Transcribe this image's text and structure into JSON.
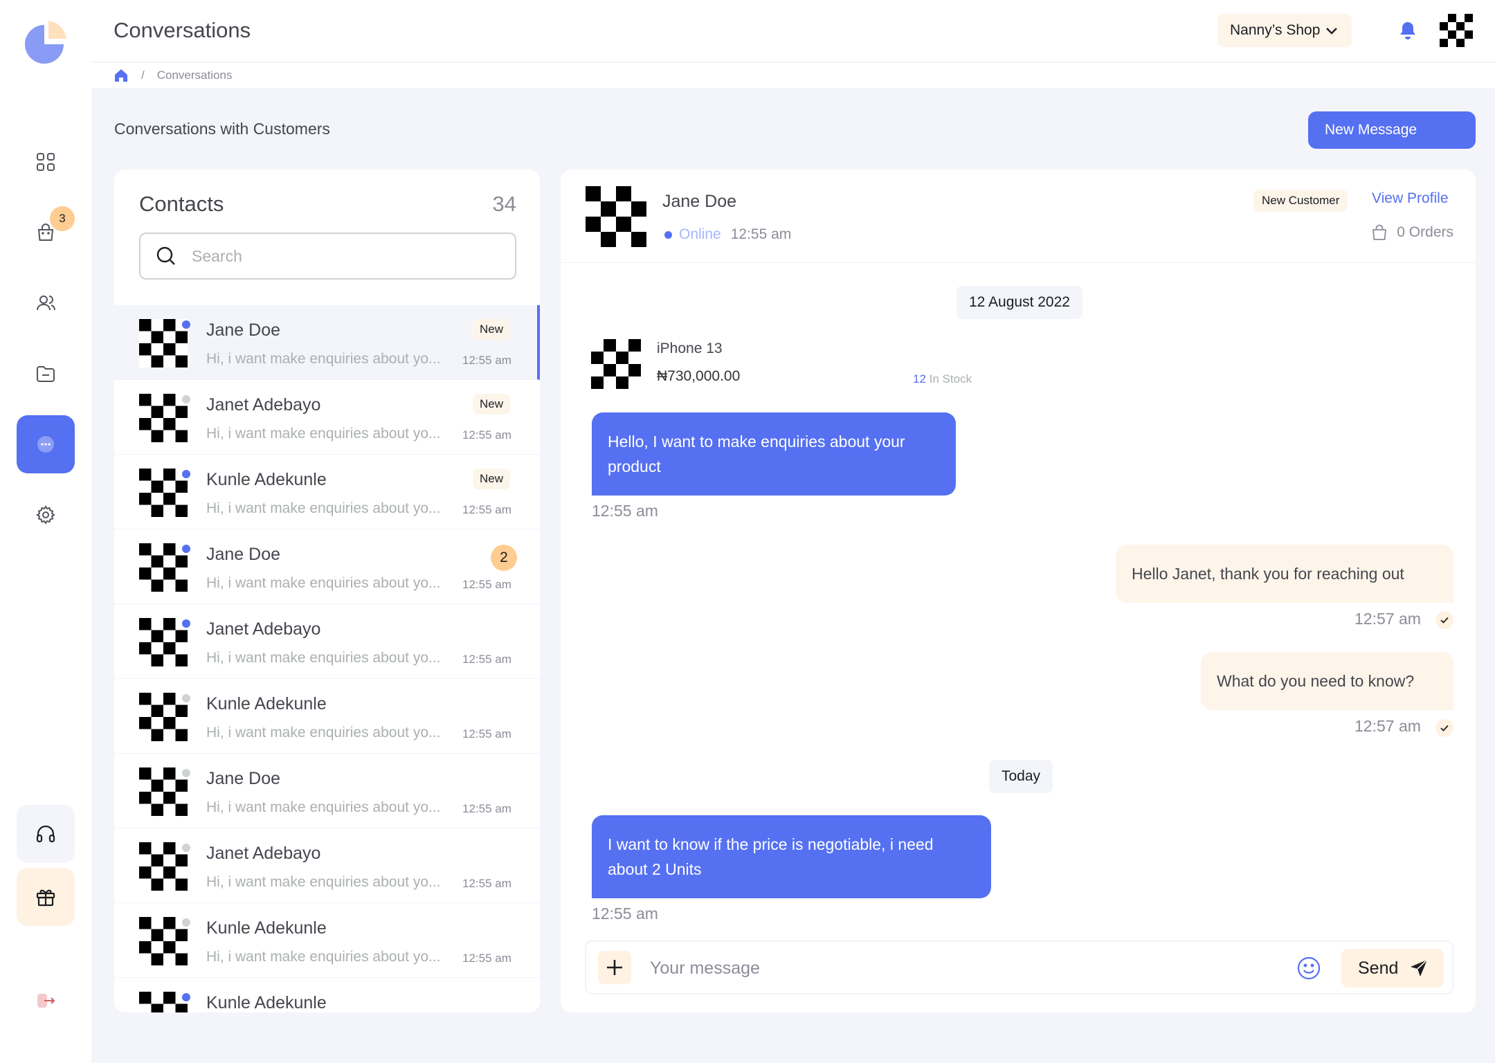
{
  "header": {
    "title": "Conversations",
    "shop_name": "Nanny’s Shop",
    "breadcrumb": "Conversations"
  },
  "sidebar": {
    "cart_badge": "3",
    "items": [
      {
        "icon": "dashboard-icon"
      },
      {
        "icon": "shopping-bag-icon"
      },
      {
        "icon": "customers-icon"
      },
      {
        "icon": "folder-icon"
      },
      {
        "icon": "chat-icon",
        "active": true
      },
      {
        "icon": "settings-icon"
      }
    ]
  },
  "page": {
    "section_title": "Conversations with Customers",
    "new_message_label": "New Message"
  },
  "contacts": {
    "title": "Contacts",
    "count": "34",
    "search_placeholder": "Search",
    "items": [
      {
        "name": "Jane Doe",
        "preview": "Hi, i want make enquiries about yo...",
        "time": "12:55 am",
        "tag": "New",
        "online": true
      },
      {
        "name": "Janet Adebayo",
        "preview": "Hi, i want make enquiries about yo...",
        "time": "12:55 am",
        "tag": "New",
        "online": false
      },
      {
        "name": "Kunle Adekunle",
        "preview": "Hi, i want make enquiries about yo...",
        "time": "12:55 am",
        "tag": "New",
        "online": true
      },
      {
        "name": "Jane Doe",
        "preview": "Hi, i want make enquiries about yo...",
        "time": "12:55 am",
        "count": "2",
        "online": true
      },
      {
        "name": "Janet Adebayo",
        "preview": "Hi, i want make enquiries about yo...",
        "time": "12:55 am",
        "online": true
      },
      {
        "name": "Kunle Adekunle",
        "preview": "Hi, i want make enquiries about yo...",
        "time": "12:55 am",
        "online": false
      },
      {
        "name": "Jane Doe",
        "preview": "Hi, i want make enquiries about yo...",
        "time": "12:55 am",
        "online": false
      },
      {
        "name": "Janet Adebayo",
        "preview": "Hi, i want make enquiries about yo...",
        "time": "12:55 am",
        "online": false
      },
      {
        "name": "Kunle Adekunle",
        "preview": "Hi, i want make enquiries about yo...",
        "time": "12:55 am",
        "online": false
      },
      {
        "name": "Kunle Adekunle",
        "preview": "",
        "time": "",
        "online": true
      }
    ]
  },
  "chat": {
    "name": "Jane Doe",
    "status": "Online",
    "status_time": "12:55 am",
    "customer_tag": "New Customer",
    "view_profile": "View Profile",
    "orders": "0 Orders",
    "date_1": "12 August 2022",
    "date_2": "Today",
    "product": {
      "name": "iPhone 13",
      "price": "₦730,000.00",
      "stock_count": "12",
      "stock_label": "In Stock"
    },
    "messages": [
      {
        "text": "Hello, I want to make enquiries about your product",
        "time": "12:55 am"
      },
      {
        "text": "Hello Janet, thank you for reaching out",
        "time": "12:57 am"
      },
      {
        "text": "What do you need to know?",
        "time": "12:57 am"
      },
      {
        "text": "I want to know if the price is negotiable, i need about 2 Units",
        "time": "12:55 am"
      }
    ],
    "input_placeholder": "Your message",
    "send_label": "Send"
  },
  "colors": {
    "primary": "#5570F1",
    "secondary": "#FFCC91",
    "cream": "#FEF5EA",
    "background": "#F4F5FA"
  }
}
